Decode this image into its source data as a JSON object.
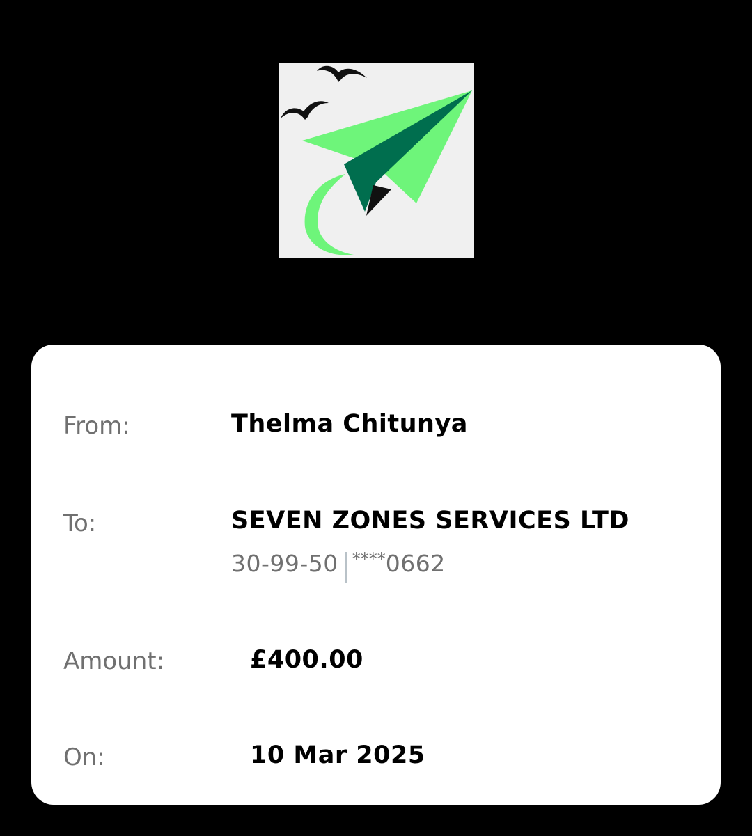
{
  "receipt": {
    "from_label": "From:",
    "from_value": "Thelma Chitunya",
    "to_label": "To:",
    "to_value": "SEVEN ZONES SERVICES LTD",
    "sort_code": "30-99-50",
    "account_mask": "****",
    "account_last4": "0662",
    "amount_label": "Amount:",
    "amount_value": "£400.00",
    "date_label": "On:",
    "date_value": "10 Mar 2025"
  },
  "colors": {
    "background": "#000000",
    "card": "#ffffff",
    "label": "#707070",
    "logo_light_green": "#6ef57a",
    "logo_dark_green": "#006e4e"
  },
  "icons": {
    "logo": "paper-plane-birds-logo"
  }
}
